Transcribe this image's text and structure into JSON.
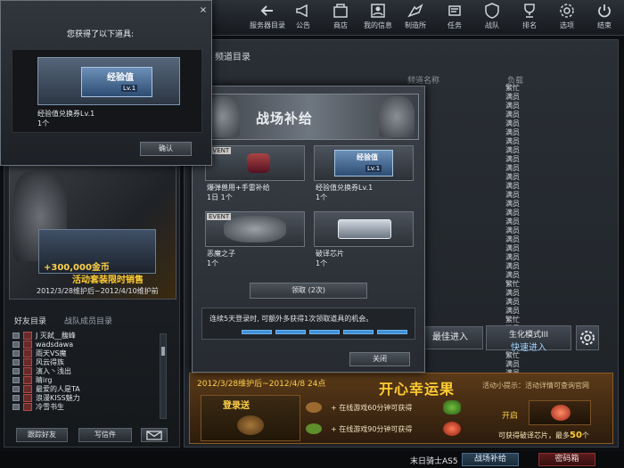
{
  "nav": {
    "items": [
      {
        "label": "服务器目录",
        "icon": "arrow-left-icon"
      },
      {
        "label": "公告",
        "icon": "megaphone-icon"
      },
      {
        "label": "商店",
        "icon": "shop-icon"
      },
      {
        "label": "我的信息",
        "icon": "profile-icon"
      },
      {
        "label": "制造所",
        "icon": "factory-icon"
      },
      {
        "label": "任务",
        "icon": "mission-icon"
      },
      {
        "label": "战队",
        "icon": "shield-icon"
      },
      {
        "label": "排名",
        "icon": "trophy-icon"
      },
      {
        "label": "选项",
        "icon": "gear-icon"
      },
      {
        "label": "结束",
        "icon": "power-icon"
      }
    ]
  },
  "main": {
    "title": "频道目录",
    "col_channel": "频道名称",
    "col_load": "负载",
    "statuses": [
      "繁忙",
      "满员",
      "满员",
      "满员",
      "满员",
      "满员",
      "满员",
      "满员",
      "满员",
      "满员",
      "满员",
      "满员",
      "满员",
      "满员",
      "满员",
      "满员",
      "满员",
      "满员",
      "满员",
      "满员",
      "满员",
      "满员",
      "繁忙",
      "满员",
      "满员",
      "满员",
      "繁忙",
      "满员",
      "满员",
      "满员",
      "繁忙",
      "满员",
      "满员"
    ],
    "enter_button": "最佳进入",
    "quick_button_line1": "生化模式III",
    "quick_button_line2": "快速进入"
  },
  "promo": {
    "date": "2012/3/28维护后~2012/4/8 24点",
    "title": "开心幸运果",
    "tip": "活动小提示：活动详情可查询官网",
    "gift_label": "登录送",
    "row1": "+ 在线游戏60分钟可获得",
    "row2": "+ 在线游戏90分钟可获得",
    "open_label": "开启",
    "footer_prefix": "可获得破译芯片，最多",
    "footer_count": "50",
    "footer_unit": "个"
  },
  "status_bar": {
    "player_name": "末日骑士AS5",
    "supply_button": "战场补给",
    "password_button": "密码箱"
  },
  "left": {
    "banner_gold": "+300,000金币",
    "banner_sale": "活动套装限时销售",
    "banner_dates": "2012/3/28维护后~2012/4/10维护前",
    "tab_friends": "好友目录",
    "tab_clan": "战队成员目录",
    "friends": [
      "J 灭弑__馥峰",
      "wadsdawa",
      "雨天VS魔",
      "风云得族",
      "演入丶浅出",
      "睛irg",
      "最爱的人是TA",
      "浪漫KISS魅力",
      "冷雪书生"
    ],
    "btn_follow": "跟踪好友",
    "btn_write": "写信件"
  },
  "supply": {
    "title": "战场补给",
    "items": [
      {
        "event": "EVENT",
        "name": "爆弹兽用+手雷补给",
        "qty": "1日 1个"
      },
      {
        "event": "",
        "name": "经验值兑换券Lv.1",
        "qty": "1个"
      },
      {
        "event": "EVENT",
        "name": "恶魔之子",
        "qty": "1个"
      },
      {
        "event": "",
        "name": "破译芯片",
        "qty": "1个"
      }
    ],
    "claim_button": "领取 (2次)",
    "description": "连续5天登录时, 可额外多获得1次领取道具的机会。",
    "progress_filled": 5,
    "close_button": "关闭"
  },
  "received": {
    "title": "您获得了以下道具:",
    "item_name": "经验值兑换券Lv.1",
    "item_qty": "1个",
    "voucher_text": "经验值",
    "voucher_level": "Lv.1",
    "ok_button": "确认"
  }
}
